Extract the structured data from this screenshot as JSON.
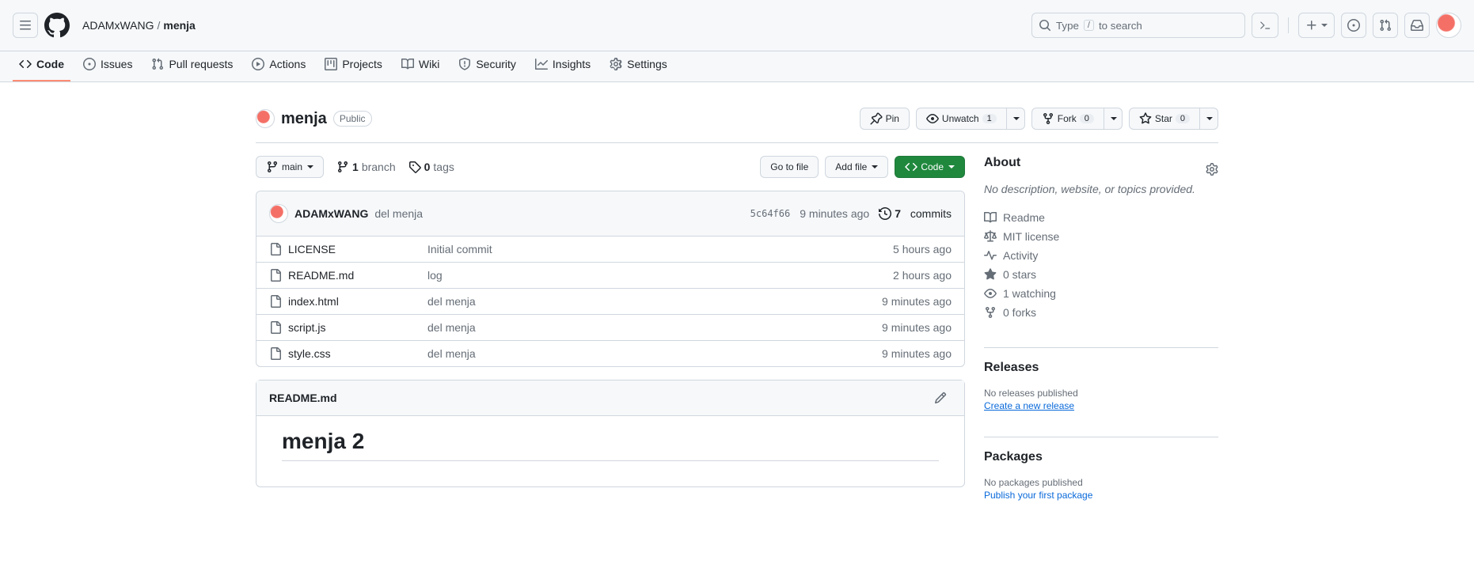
{
  "header": {
    "owner": "ADAMxWANG",
    "repo": "menja",
    "search_placeholder": "Type",
    "search_suffix": "to search",
    "search_key": "/"
  },
  "nav": [
    {
      "label": "Code",
      "active": true
    },
    {
      "label": "Issues"
    },
    {
      "label": "Pull requests"
    },
    {
      "label": "Actions"
    },
    {
      "label": "Projects"
    },
    {
      "label": "Wiki"
    },
    {
      "label": "Security"
    },
    {
      "label": "Insights"
    },
    {
      "label": "Settings"
    }
  ],
  "repo": {
    "name": "menja",
    "visibility": "Public",
    "pin": "Pin",
    "watch": {
      "label": "Unwatch",
      "count": "1"
    },
    "fork": {
      "label": "Fork",
      "count": "0"
    },
    "star": {
      "label": "Star",
      "count": "0"
    }
  },
  "filetoolbar": {
    "branch": "main",
    "branches_count": "1",
    "branches_label": "branch",
    "tags_count": "0",
    "tags_label": "tags",
    "goto": "Go to file",
    "addfile": "Add file",
    "code": "Code"
  },
  "latest_commit": {
    "author": "ADAMxWANG",
    "message": "del menja",
    "sha": "5c64f66",
    "time": "9 minutes ago",
    "commits_count": "7",
    "commits_label": "commits"
  },
  "files": [
    {
      "name": "LICENSE",
      "msg": "Initial commit",
      "time": "5 hours ago"
    },
    {
      "name": "README.md",
      "msg": "log",
      "time": "2 hours ago"
    },
    {
      "name": "index.html",
      "msg": "del menja",
      "time": "9 minutes ago"
    },
    {
      "name": "script.js",
      "msg": "del menja",
      "time": "9 minutes ago"
    },
    {
      "name": "style.css",
      "msg": "del menja",
      "time": "9 minutes ago"
    }
  ],
  "readme": {
    "filename": "README.md",
    "heading": "menja 2"
  },
  "about": {
    "title": "About",
    "desc": "No description, website, or topics provided.",
    "items": [
      {
        "icon": "book",
        "label": "Readme"
      },
      {
        "icon": "law",
        "label": "MIT license"
      },
      {
        "icon": "pulse",
        "label": "Activity"
      },
      {
        "icon": "star",
        "label": "0 stars"
      },
      {
        "icon": "eye",
        "label": "1 watching"
      },
      {
        "icon": "fork",
        "label": "0 forks"
      }
    ]
  },
  "releases": {
    "title": "Releases",
    "none": "No releases published",
    "create": "Create a new release"
  },
  "packages": {
    "title": "Packages",
    "none": "No packages published",
    "publish": "Publish your first package"
  }
}
